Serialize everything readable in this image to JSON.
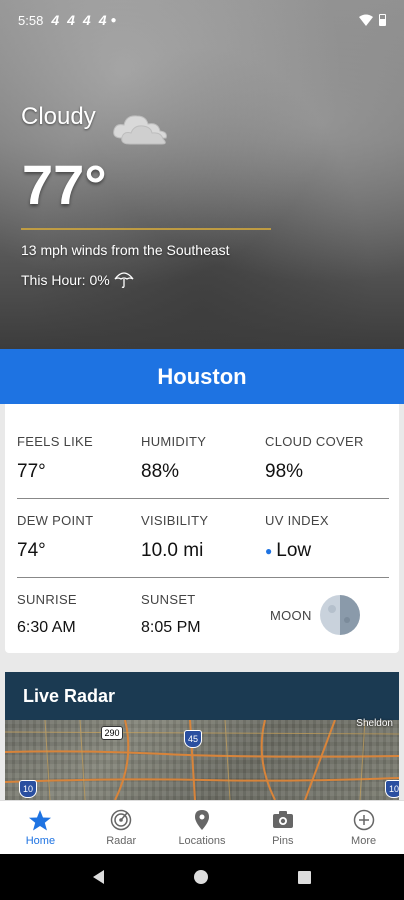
{
  "status": {
    "time": "5:58",
    "icons": [
      "4",
      "4",
      "4",
      "4"
    ]
  },
  "hero": {
    "condition": "Cloudy",
    "temperature": "77°",
    "wind": "13 mph winds from the Southeast",
    "this_hour": "This Hour: 0%"
  },
  "city": "Houston",
  "details": {
    "feels_like": {
      "label": "FEELS LIKE",
      "value": "77°"
    },
    "humidity": {
      "label": "HUMIDITY",
      "value": "88%"
    },
    "cloud_cover": {
      "label": "CLOUD COVER",
      "value": "98%"
    },
    "dew_point": {
      "label": "DEW POINT",
      "value": "74°"
    },
    "visibility": {
      "label": "VISIBILITY",
      "value": "10.0 mi"
    },
    "uv_index": {
      "label": "UV INDEX",
      "value": "Low"
    },
    "sunrise": {
      "label": "SUNRISE",
      "value": "6:30 AM"
    },
    "sunset": {
      "label": "SUNSET",
      "value": "8:05 PM"
    },
    "moon": {
      "label": "MOON"
    }
  },
  "radar": {
    "title": "Live Radar",
    "map_label": "Sheldon",
    "shields": [
      "290",
      "45",
      "10",
      "10"
    ]
  },
  "nav": {
    "items": [
      {
        "label": "Home",
        "icon": "star-icon",
        "active": true
      },
      {
        "label": "Radar",
        "icon": "radar-icon"
      },
      {
        "label": "Locations",
        "icon": "location-pin-icon"
      },
      {
        "label": "Pins",
        "icon": "camera-icon"
      },
      {
        "label": "More",
        "icon": "plus-circle-icon"
      }
    ]
  },
  "colors": {
    "accent": "#1e73e2",
    "radar_header": "#1b3a52",
    "divider_gold": "#c9a23f"
  }
}
